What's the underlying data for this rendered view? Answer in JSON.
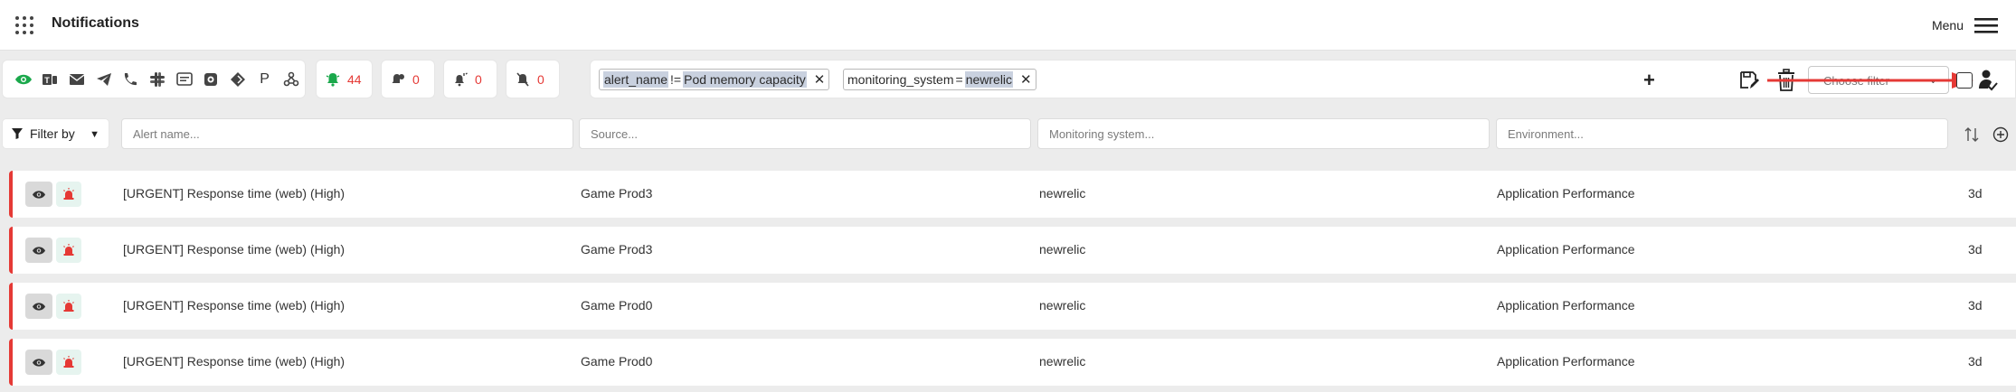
{
  "header": {
    "title": "Notifications",
    "menu_label": "Menu"
  },
  "toolbar": {
    "channels": [
      "eye-icon",
      "ms-teams-icon",
      "email-icon",
      "telegram-icon",
      "phone-icon",
      "slack-icon",
      "message-icon",
      "chip-icon",
      "webhook-icon",
      "P",
      "integration-icon"
    ],
    "counters": [
      {
        "icon": "alert-bell-icon",
        "value": "44",
        "color": "#e53935"
      },
      {
        "icon": "acknowledged-icon",
        "value": "0",
        "color": "#e53935"
      },
      {
        "icon": "alarm-icon",
        "value": "0",
        "color": "#e53935"
      },
      {
        "icon": "muted-bell-icon",
        "value": "0",
        "color": "#e53935"
      }
    ],
    "chips": [
      {
        "field": "alert_name",
        "operator": "!=",
        "value": "Pod memory capacity"
      },
      {
        "field": "monitoring_system",
        "operator": "=",
        "value": "newrelic"
      }
    ],
    "choose_filter_placeholder": "Choose filter"
  },
  "filters": {
    "filter_by_label": "Filter by",
    "alert_name_placeholder": "Alert name...",
    "source_placeholder": "Source...",
    "monitoring_placeholder": "Monitoring system...",
    "environment_placeholder": "Environment..."
  },
  "rows": [
    {
      "name": "[URGENT] Response time (web) (High)",
      "source": "Game Prod3",
      "monitoring": "newrelic",
      "environment": "Application Performance",
      "age": "3d"
    },
    {
      "name": "[URGENT] Response time (web) (High)",
      "source": "Game Prod3",
      "monitoring": "newrelic",
      "environment": "Application Performance",
      "age": "3d"
    },
    {
      "name": "[URGENT] Response time (web) (High)",
      "source": "Game Prod0",
      "monitoring": "newrelic",
      "environment": "Application Performance",
      "age": "3d"
    },
    {
      "name": "[URGENT] Response time (web) (High)",
      "source": "Game Prod0",
      "monitoring": "newrelic",
      "environment": "Application Performance",
      "age": "3d"
    }
  ],
  "colors": {
    "accent_green": "#1aa84b",
    "alert_red": "#e53935",
    "chip_highlight": "#c9d1df"
  }
}
